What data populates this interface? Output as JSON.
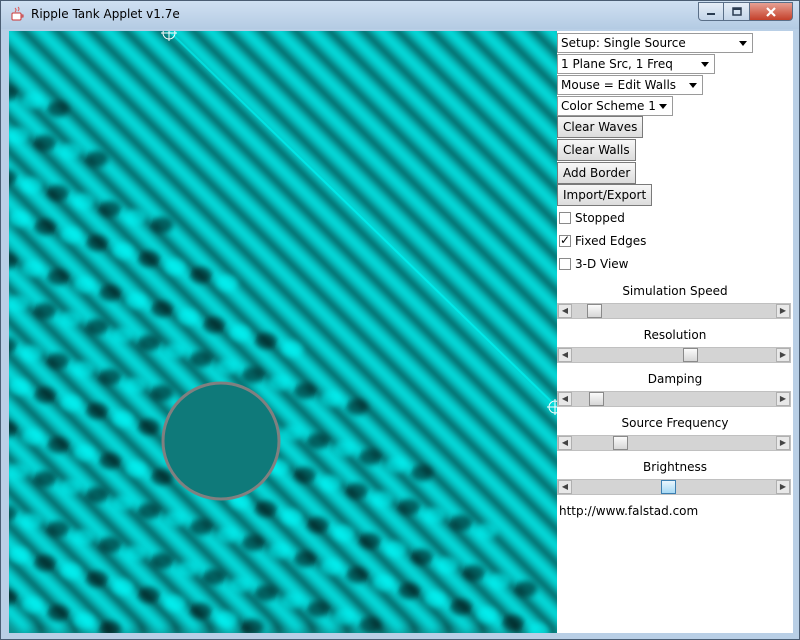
{
  "window": {
    "title": "Ripple Tank Applet v1.7e",
    "controls": [
      "minimize",
      "maximize",
      "close"
    ]
  },
  "colors": {
    "wave_dark": "#000000",
    "wave_mid": "#0d8d8d",
    "wave_bright": "#00ffff",
    "wall": "#808080",
    "disk_fill": "#0f7a7a"
  },
  "controls": {
    "setup_select": "Setup: Single Source",
    "source_select": "1 Plane Src, 1 Freq",
    "mouse_select": "Mouse = Edit Walls",
    "color_select": "Color Scheme 1",
    "clear_waves": "Clear Waves",
    "clear_walls": "Clear Walls",
    "add_border": "Add Border",
    "import_export": "Import/Export",
    "stopped": {
      "label": "Stopped",
      "checked": false
    },
    "fixed_edges": {
      "label": "Fixed Edges",
      "checked": true
    },
    "view3d": {
      "label": "3-D View",
      "checked": false
    }
  },
  "sliders": [
    {
      "label": "Simulation Speed",
      "value": 0.1
    },
    {
      "label": "Resolution",
      "value": 0.58
    },
    {
      "label": "Damping",
      "value": 0.11
    },
    {
      "label": "Source Frequency",
      "value": 0.23
    },
    {
      "label": "Brightness",
      "value": 0.47
    }
  ],
  "url": "http://www.falstad.com"
}
